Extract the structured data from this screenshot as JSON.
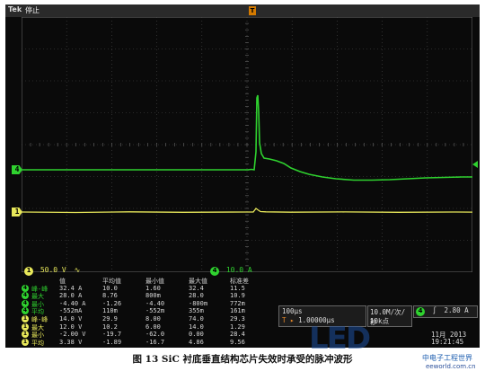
{
  "window": {
    "brand": "Tek",
    "status": "停止",
    "trigger_position_marker": "T"
  },
  "channels": {
    "ch1": {
      "number": "1",
      "color": "#e8e85a",
      "scale": "50.0 V",
      "coupling": "∿"
    },
    "ch4": {
      "number": "4",
      "color": "#2fd22f",
      "scale": "10.0 A"
    }
  },
  "waveform": {
    "ch4_label": "4",
    "ch1_label": "1"
  },
  "measurements": {
    "headers": [
      "值",
      "平均值",
      "最小值",
      "最大值",
      "标准差"
    ],
    "rows": [
      {
        "ch": "4",
        "color": "#2fd22f",
        "label": "峰-峰",
        "values": [
          "32.4 A",
          "10.0",
          "1.60",
          "32.4",
          "11.5"
        ]
      },
      {
        "ch": "4",
        "color": "#2fd22f",
        "label": "最大",
        "values": [
          "28.0 A",
          "8.76",
          "800m",
          "28.0",
          "10.9"
        ]
      },
      {
        "ch": "4",
        "color": "#2fd22f",
        "label": "最小",
        "values": [
          "-4.40 A",
          "-1.26",
          "-4.40",
          "-800m",
          "772m"
        ]
      },
      {
        "ch": "4",
        "color": "#2fd22f",
        "label": "平均",
        "values": [
          "-552mA",
          "110m",
          "-552m",
          "355m",
          "161m"
        ]
      },
      {
        "ch": "1",
        "color": "#e8e85a",
        "label": "峰-峰",
        "values": [
          "14.0 V",
          "29.9",
          "8.00",
          "74.0",
          "29.3"
        ]
      },
      {
        "ch": "1",
        "color": "#e8e85a",
        "label": "最大",
        "values": [
          "12.0 V",
          "10.2",
          "6.00",
          "14.0",
          "1.29"
        ]
      },
      {
        "ch": "1",
        "color": "#e8e85a",
        "label": "最小",
        "values": [
          "-2.00 V",
          "-19.7",
          "-62.0",
          "0.00",
          "28.4"
        ]
      },
      {
        "ch": "1",
        "color": "#e8e85a",
        "label": "平均",
        "values": [
          "3.38 V",
          "-1.89",
          "-16.7",
          "4.86",
          "9.56"
        ]
      }
    ]
  },
  "timebase": {
    "scale": "100μs",
    "position": "1.00000μs",
    "position_marker": "T",
    "sample_rate": "10.0M/次/秒",
    "record_length": "10k点"
  },
  "trigger": {
    "source": "4",
    "slope": "∫",
    "level": "2.80 A"
  },
  "clock": {
    "date": "11月  2013",
    "time": "19:21:45"
  },
  "watermark": {
    "logo": "LED",
    "site_cn": "中电子工程世界",
    "site": "eeworld.com.cn"
  },
  "caption": "图 13  SiC 衬底垂直结构芯片失效时承受的脉冲波形",
  "colors": {
    "ch1": "#e8e85a",
    "ch4": "#2fd22f",
    "grid": "#5a5a5a",
    "background": "#0a0a0a"
  }
}
